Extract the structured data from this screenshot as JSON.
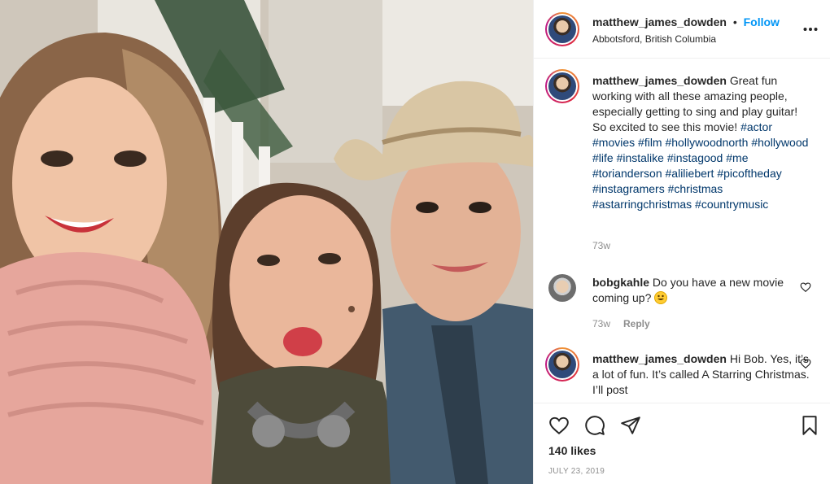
{
  "post": {
    "username": "matthew_james_dowden",
    "follow_label": "Follow",
    "dot": "•",
    "location": "Abbotsford, British Columbia",
    "more_label": "•••"
  },
  "caption": {
    "username": "matthew_james_dowden",
    "text": "Great fun working with all these amazing people, especially getting to sing and play guitar! So excited to see this movie!",
    "hashtags": [
      "#actor",
      "#movies",
      "#film",
      "#hollywoodnorth",
      "#hollywood",
      "#life",
      "#instalike",
      "#instagood",
      "#me",
      "#torianderson",
      "#aliliebert",
      "#picoftheday",
      "#instagramers",
      "#christmas",
      "#astarringchristmas",
      "#countrymusic"
    ],
    "time": "73w"
  },
  "comments": [
    {
      "username": "bobgkahle",
      "text": "Do you have a new movie coming up?",
      "emoji": "grinning-face-emoji",
      "time": "73w",
      "reply_label": "Reply"
    },
    {
      "username": "matthew_james_dowden",
      "text": "Hi Bob. Yes, it’s a lot of fun. It’s called A Starring Christmas. I’ll post"
    }
  ],
  "footer": {
    "likes": "140 likes",
    "date": "JULY 23, 2019"
  },
  "icons": {
    "like": "heart-icon",
    "comment": "comment-icon",
    "share": "paper-plane-icon",
    "save": "bookmark-icon"
  },
  "colors": {
    "accent": "#0095f6",
    "hashtag": "#00376b",
    "muted": "#8e8e8e",
    "border": "#efefef"
  }
}
